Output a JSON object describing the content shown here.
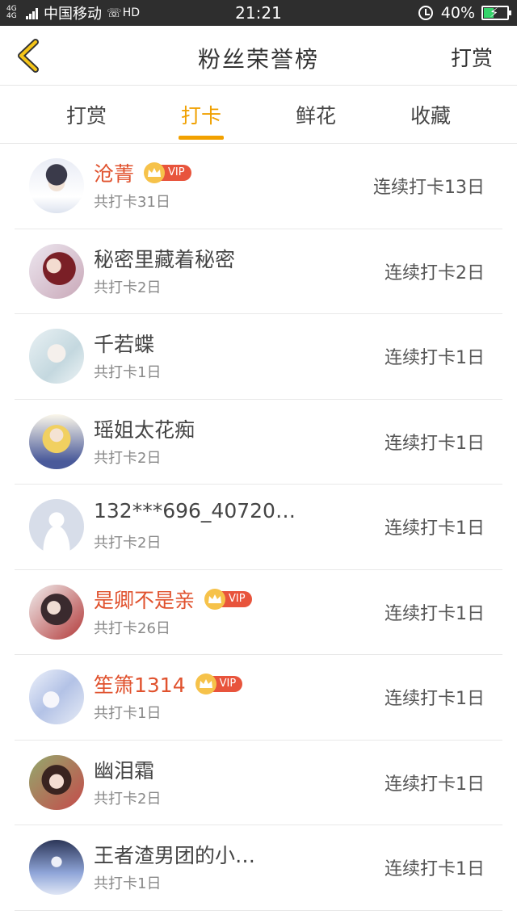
{
  "status_bar": {
    "signal": "4G 4G",
    "carrier": "中国移动",
    "hd": "HD",
    "time": "21:21",
    "battery_percent": "40%",
    "battery_level": 0.4
  },
  "header": {
    "title": "粉丝荣誉榜",
    "action": "打赏",
    "accent_color": "#f2a100"
  },
  "tabs": [
    {
      "label": "打赏",
      "active": false
    },
    {
      "label": "打卡",
      "active": true
    },
    {
      "label": "鲜花",
      "active": false
    },
    {
      "label": "收藏",
      "active": false
    }
  ],
  "fans": [
    {
      "name": "沧菁",
      "vip": true,
      "vip_label": "VIP",
      "total": "共打卡31日",
      "streak": "连续打卡13日",
      "avatar": "avatar-boy-white-shirt"
    },
    {
      "name": "秘密里藏着秘密",
      "vip": false,
      "total": "共打卡2日",
      "streak": "连续打卡2日",
      "avatar": "avatar-anime-red-hair"
    },
    {
      "name": "千若蝶",
      "vip": false,
      "total": "共打卡1日",
      "streak": "连续打卡1日",
      "avatar": "avatar-anime-pale"
    },
    {
      "name": "瑶姐太花痴",
      "vip": false,
      "total": "共打卡2日",
      "streak": "连续打卡1日",
      "avatar": "avatar-anime-blonde"
    },
    {
      "name": "132***696_40720…",
      "vip": false,
      "total": "共打卡2日",
      "streak": "连续打卡1日",
      "avatar": "avatar-default"
    },
    {
      "name": "是卿不是亲",
      "vip": true,
      "vip_label": "VIP",
      "total": "共打卡26日",
      "streak": "连续打卡1日",
      "avatar": "avatar-anime-dark"
    },
    {
      "name": "笙箫1314",
      "vip": true,
      "vip_label": "VIP",
      "total": "共打卡1日",
      "streak": "连续打卡1日",
      "avatar": "avatar-anime-blue"
    },
    {
      "name": "幽泪霜",
      "vip": false,
      "total": "共打卡2日",
      "streak": "连续打卡1日",
      "avatar": "avatar-anime-girl"
    },
    {
      "name": "王者渣男团的小…",
      "vip": false,
      "total": "共打卡1日",
      "streak": "连续打卡1日",
      "avatar": "avatar-anime-night"
    }
  ]
}
